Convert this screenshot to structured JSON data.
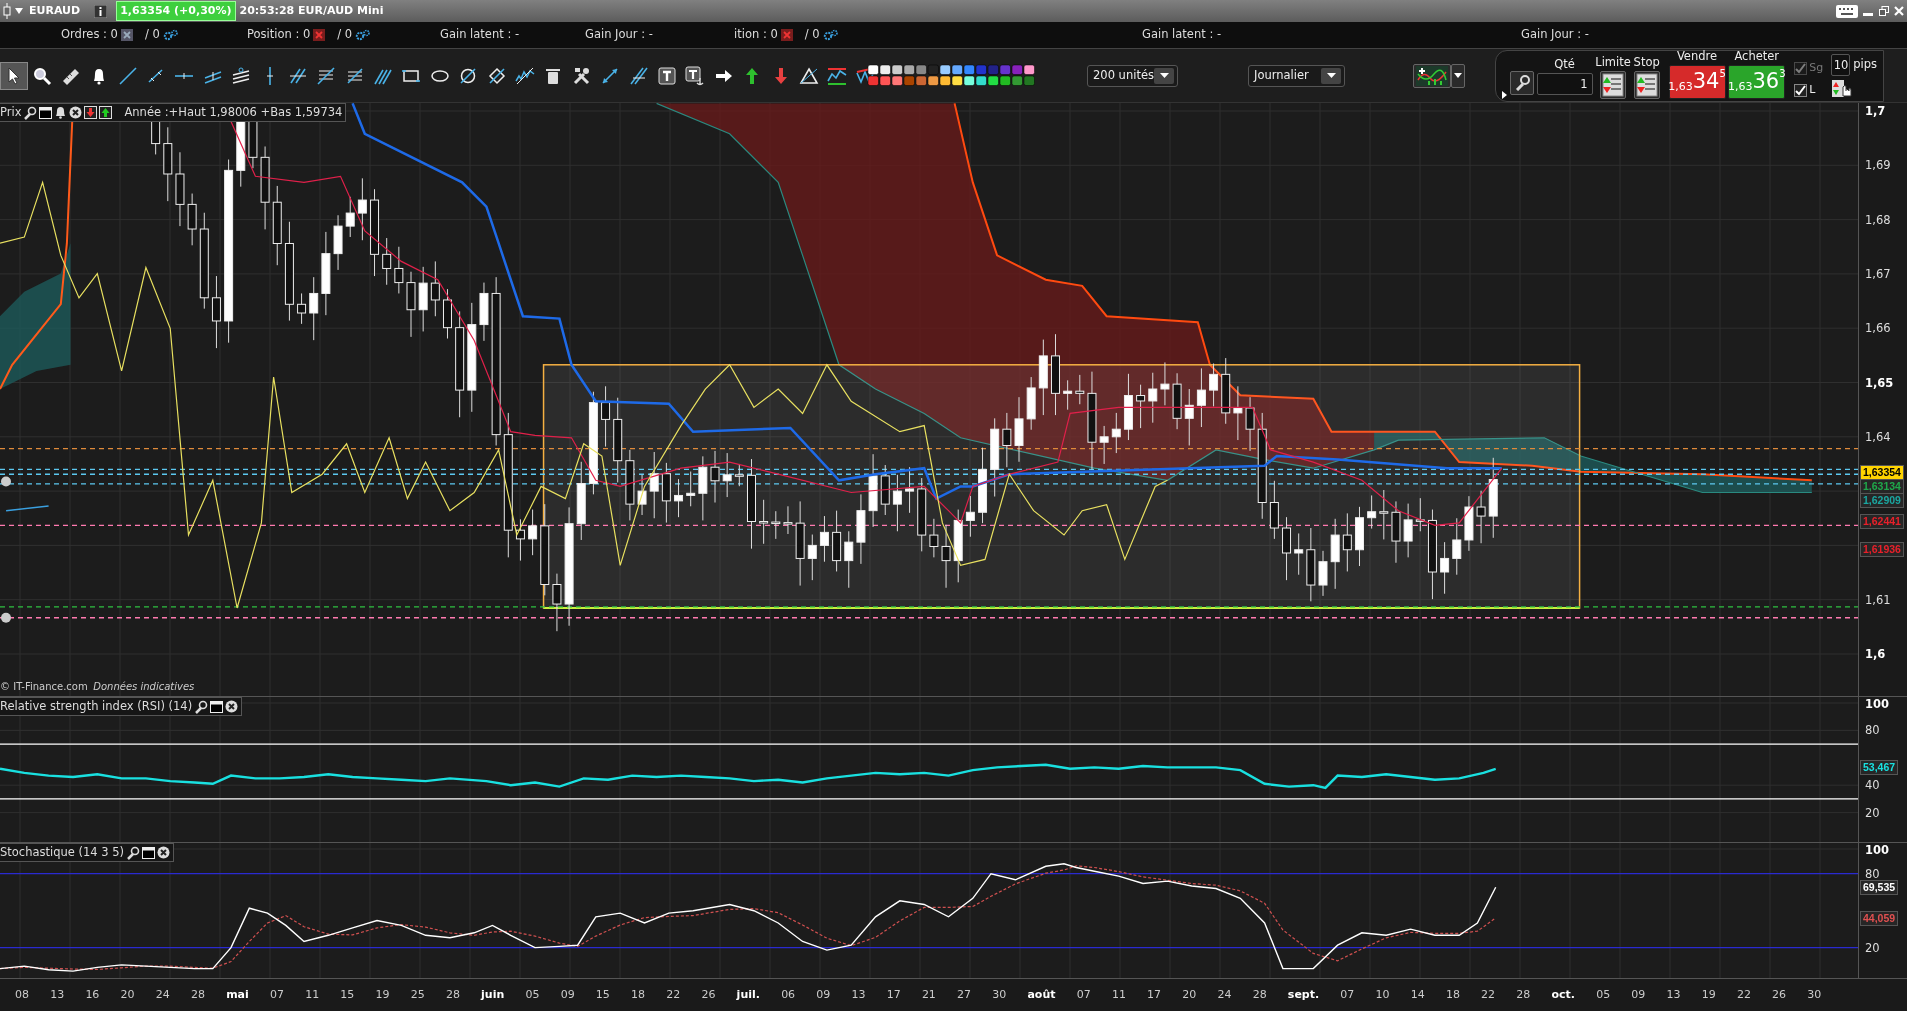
{
  "title_bar": {
    "symbol": "EURAUD",
    "price_badge": "1,63354 (+0,30%)",
    "time_label": "20:53:28 EUR/AUD Mini"
  },
  "info_bar": [
    {
      "label": "Ordres : 0",
      "kind": "counter",
      "disabled": true,
      "total": "/ 0"
    },
    {
      "label": "Position : 0",
      "kind": "counter",
      "disabled": false,
      "total": "/ 0"
    },
    {
      "label": "Gain latent : -",
      "kind": "text"
    },
    {
      "label": "Gain Jour : -",
      "kind": "text"
    },
    {
      "label": "ition : 0",
      "kind": "counter",
      "disabled": false,
      "total": "/ 0"
    },
    {
      "label": "Gain latent : -",
      "kind": "text"
    },
    {
      "label": "Gain Jour : -",
      "kind": "text"
    }
  ],
  "toolbar": {
    "tools": [
      {
        "selected": true
      },
      {
        "selected": false
      },
      {
        "selected": false
      },
      {
        "selected": false
      },
      {
        "selected": false
      },
      {
        "selected": false
      },
      {
        "selected": false
      },
      {
        "selected": false
      },
      {
        "selected": false
      },
      {
        "selected": false
      },
      {
        "selected": false
      },
      {
        "selected": false
      },
      {
        "selected": false
      },
      {
        "selected": false
      },
      {
        "selected": false
      },
      {
        "selected": false
      },
      {
        "selected": false
      },
      {
        "selected": false
      },
      {
        "selected": false
      },
      {
        "selected": false
      },
      {
        "selected": false
      },
      {
        "selected": false
      },
      {
        "selected": false
      },
      {
        "selected": false
      },
      {
        "selected": false
      },
      {
        "selected": false
      },
      {
        "selected": false
      },
      {
        "selected": false
      },
      {
        "selected": false
      },
      {
        "selected": false
      },
      {
        "selected": false
      }
    ],
    "quantity_select": "200 unités",
    "period_select": "Journalier"
  },
  "trade_panel": {
    "qty_label": "Qté",
    "qty_value": "1",
    "limit_label": "Limite",
    "stop_label": "Stop",
    "sell_label": "Vendre",
    "sell_price": {
      "prefix": "1,63",
      "main": "34",
      "suffix": "5"
    },
    "buy_label": "Acheter",
    "buy_price": {
      "prefix": "1,63",
      "main": "36",
      "suffix": "3"
    },
    "options": [
      {
        "label": "Sg",
        "checked": true,
        "disabled": true
      },
      {
        "label": "L",
        "checked": true,
        "disabled": false
      }
    ],
    "pips_value": "10",
    "pips_label": "pips"
  },
  "price_panel": {
    "title": "Prix",
    "info": "Année :+Haut 1,98006 +Bas 1,59734",
    "axis": [
      {
        "label": "1,7",
        "kind": "major"
      },
      {
        "label": "1,69",
        "kind": "minor"
      },
      {
        "label": "1,68",
        "kind": "minor"
      },
      {
        "label": "1,67",
        "kind": "minor"
      },
      {
        "label": "1,66",
        "kind": "minor"
      },
      {
        "label": "1,65",
        "kind": "major"
      },
      {
        "label": "1,64",
        "kind": "minor"
      },
      {
        "label": "1,61",
        "kind": "minor"
      },
      {
        "label": "1,6",
        "kind": "major"
      }
    ],
    "price_tags": [
      {
        "text": "1,63354",
        "color": "#ffd400",
        "kind": "filled"
      },
      {
        "text": "1,63134",
        "color": "#1fa84a",
        "kind": "outline"
      },
      {
        "text": "1,62909",
        "color": "#1aa6a0",
        "kind": "outline"
      },
      {
        "text": "1,62441",
        "color": "#e8202a",
        "kind": "outline"
      },
      {
        "text": "1,61936",
        "color": "#e8202a",
        "kind": "outline"
      }
    ],
    "copyright": "© IT-Finance.com",
    "disclaimer": "Données indicatives"
  },
  "rsi_panel": {
    "title": "Relative strength index (RSI) (14)",
    "axis": [
      {
        "label": "100",
        "kind": "major"
      },
      {
        "label": "80",
        "kind": "minor"
      },
      {
        "label": "40",
        "kind": "minor"
      },
      {
        "label": "20",
        "kind": "minor"
      }
    ],
    "value_tag": {
      "text": "53,467",
      "color": "#19e0e0"
    }
  },
  "stoch_panel": {
    "title": "Stochastique (14 3 5)",
    "axis": [
      {
        "label": "100",
        "kind": "major"
      },
      {
        "label": "80",
        "kind": "minor"
      },
      {
        "label": "20",
        "kind": "minor"
      }
    ],
    "value_tags": [
      {
        "text": "69,535",
        "color": "#ffffff"
      },
      {
        "text": "44,059",
        "color": "#e05050"
      }
    ]
  },
  "x_axis": [
    {
      "label": "08",
      "kind": "day"
    },
    {
      "label": "13",
      "kind": "day"
    },
    {
      "label": "16",
      "kind": "day"
    },
    {
      "label": "20",
      "kind": "day"
    },
    {
      "label": "24",
      "kind": "day"
    },
    {
      "label": "28",
      "kind": "day"
    },
    {
      "label": "mai",
      "kind": "month"
    },
    {
      "label": "07",
      "kind": "day"
    },
    {
      "label": "11",
      "kind": "day"
    },
    {
      "label": "15",
      "kind": "day"
    },
    {
      "label": "19",
      "kind": "day"
    },
    {
      "label": "25",
      "kind": "day"
    },
    {
      "label": "28",
      "kind": "day"
    },
    {
      "label": "juin",
      "kind": "month"
    },
    {
      "label": "05",
      "kind": "day"
    },
    {
      "label": "09",
      "kind": "day"
    },
    {
      "label": "15",
      "kind": "day"
    },
    {
      "label": "18",
      "kind": "day"
    },
    {
      "label": "22",
      "kind": "day"
    },
    {
      "label": "26",
      "kind": "day"
    },
    {
      "label": "juil.",
      "kind": "month"
    },
    {
      "label": "06",
      "kind": "day"
    },
    {
      "label": "09",
      "kind": "day"
    },
    {
      "label": "13",
      "kind": "day"
    },
    {
      "label": "17",
      "kind": "day"
    },
    {
      "label": "21",
      "kind": "day"
    },
    {
      "label": "27",
      "kind": "day"
    },
    {
      "label": "30",
      "kind": "day"
    },
    {
      "label": "août",
      "kind": "month"
    },
    {
      "label": "07",
      "kind": "day"
    },
    {
      "label": "11",
      "kind": "day"
    },
    {
      "label": "17",
      "kind": "day"
    },
    {
      "label": "20",
      "kind": "day"
    },
    {
      "label": "24",
      "kind": "day"
    },
    {
      "label": "28",
      "kind": "day"
    },
    {
      "label": "sept.",
      "kind": "month"
    },
    {
      "label": "07",
      "kind": "day"
    },
    {
      "label": "10",
      "kind": "day"
    },
    {
      "label": "14",
      "kind": "day"
    },
    {
      "label": "18",
      "kind": "day"
    },
    {
      "label": "22",
      "kind": "day"
    },
    {
      "label": "28",
      "kind": "day"
    },
    {
      "label": "oct.",
      "kind": "month"
    },
    {
      "label": "05",
      "kind": "day"
    },
    {
      "label": "09",
      "kind": "day"
    },
    {
      "label": "13",
      "kind": "day"
    },
    {
      "label": "19",
      "kind": "day"
    },
    {
      "label": "22",
      "kind": "day"
    },
    {
      "label": "26",
      "kind": "day"
    },
    {
      "label": "30",
      "kind": "day"
    }
  ]
}
